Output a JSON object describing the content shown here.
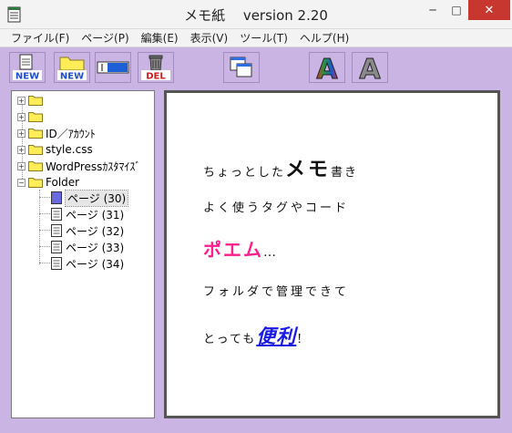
{
  "window": {
    "title": "メモ紙　 version 2.20",
    "minimize": "─",
    "maximize": "□",
    "close": "✕"
  },
  "menu": [
    {
      "label": "ファイル(F)"
    },
    {
      "label": "ページ(P)"
    },
    {
      "label": "編集(E)"
    },
    {
      "label": "表示(V)"
    },
    {
      "label": "ツール(T)"
    },
    {
      "label": "ヘルプ(H)"
    }
  ],
  "toolbar": {
    "new_page_label": "NEW",
    "new_folder_label": "NEW",
    "delete_label": "DEL",
    "font_color_letter": "A",
    "font_gray_letter": "A"
  },
  "tree": {
    "items": [
      {
        "label": "",
        "expander": "+"
      },
      {
        "label": "",
        "expander": "+"
      },
      {
        "label": "ID／ｱｶｳﾝﾄ",
        "expander": "+"
      },
      {
        "label": "style.css",
        "expander": "+"
      },
      {
        "label": "WordPressｶｽﾀﾏｲｽﾞ",
        "expander": "+"
      },
      {
        "label": "Folder",
        "expander": "−"
      }
    ],
    "pages": [
      {
        "label": "ページ (30)",
        "selected": true
      },
      {
        "label": "ページ (31)",
        "selected": false
      },
      {
        "label": "ページ (32)",
        "selected": false
      },
      {
        "label": "ページ (33)",
        "selected": false
      },
      {
        "label": "ページ (34)",
        "selected": false
      }
    ]
  },
  "content": {
    "line1_pre": "ちょっとした",
    "line1_big": "メモ",
    "line1_post": "書き",
    "line2": "よく使うタグやコード",
    "line3": "ポエム",
    "line3_dots": "…",
    "line4": "フォルダで管理できて",
    "line5_pre": "とっても",
    "line5_link": "便利",
    "line5_post": "！"
  },
  "colors": {
    "background": "#c9b4e3",
    "poem": "#ff1c8d",
    "link": "#1a1ae6",
    "folder": "#ffec57",
    "close_button": "#c7372f"
  }
}
